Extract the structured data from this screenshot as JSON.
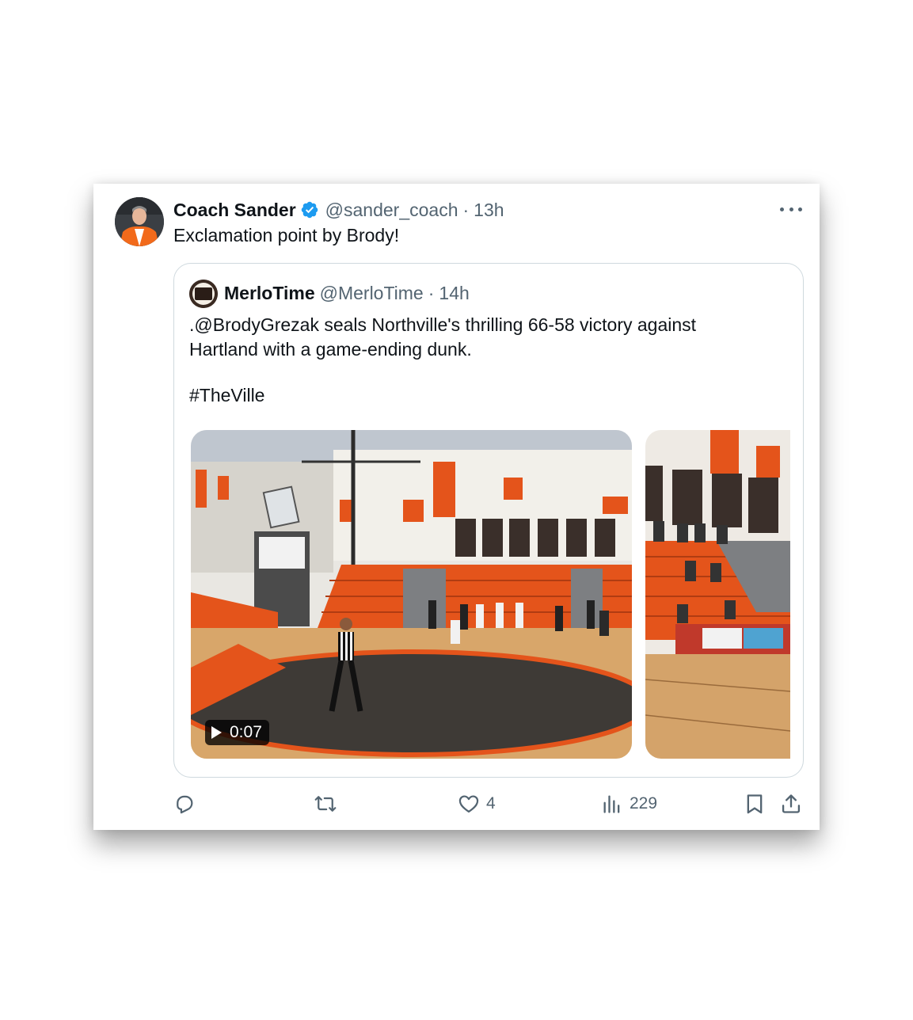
{
  "tweet": {
    "author_name": "Coach Sander",
    "handle": "@sander_coach",
    "separator": "·",
    "time": "13h",
    "text": "Exclamation point by Brody!",
    "verified": true
  },
  "quoted": {
    "author_name": "MerloTime",
    "handle": "@MerloTime",
    "separator": "·",
    "time": "14h",
    "avatar_text": "MERLO TIME",
    "text_line1": ".@BrodyGrezak seals Northville's thrilling 66-58 victory against",
    "text_line2": "Hartland with a game-ending dunk.",
    "hashtag": "#TheVille",
    "video_duration": "0:07"
  },
  "actions": {
    "replies": "",
    "reposts": "",
    "likes": "4",
    "views": "229"
  },
  "colors": {
    "verified_blue": "#1d9bf0",
    "secondary_text": "#536471",
    "border": "#cfd9de",
    "court_orange": "#e4541b"
  },
  "icons": [
    "verified-badge-icon",
    "more-icon",
    "play-icon",
    "reply-icon",
    "repost-icon",
    "like-icon",
    "views-icon",
    "bookmark-icon",
    "share-icon"
  ]
}
